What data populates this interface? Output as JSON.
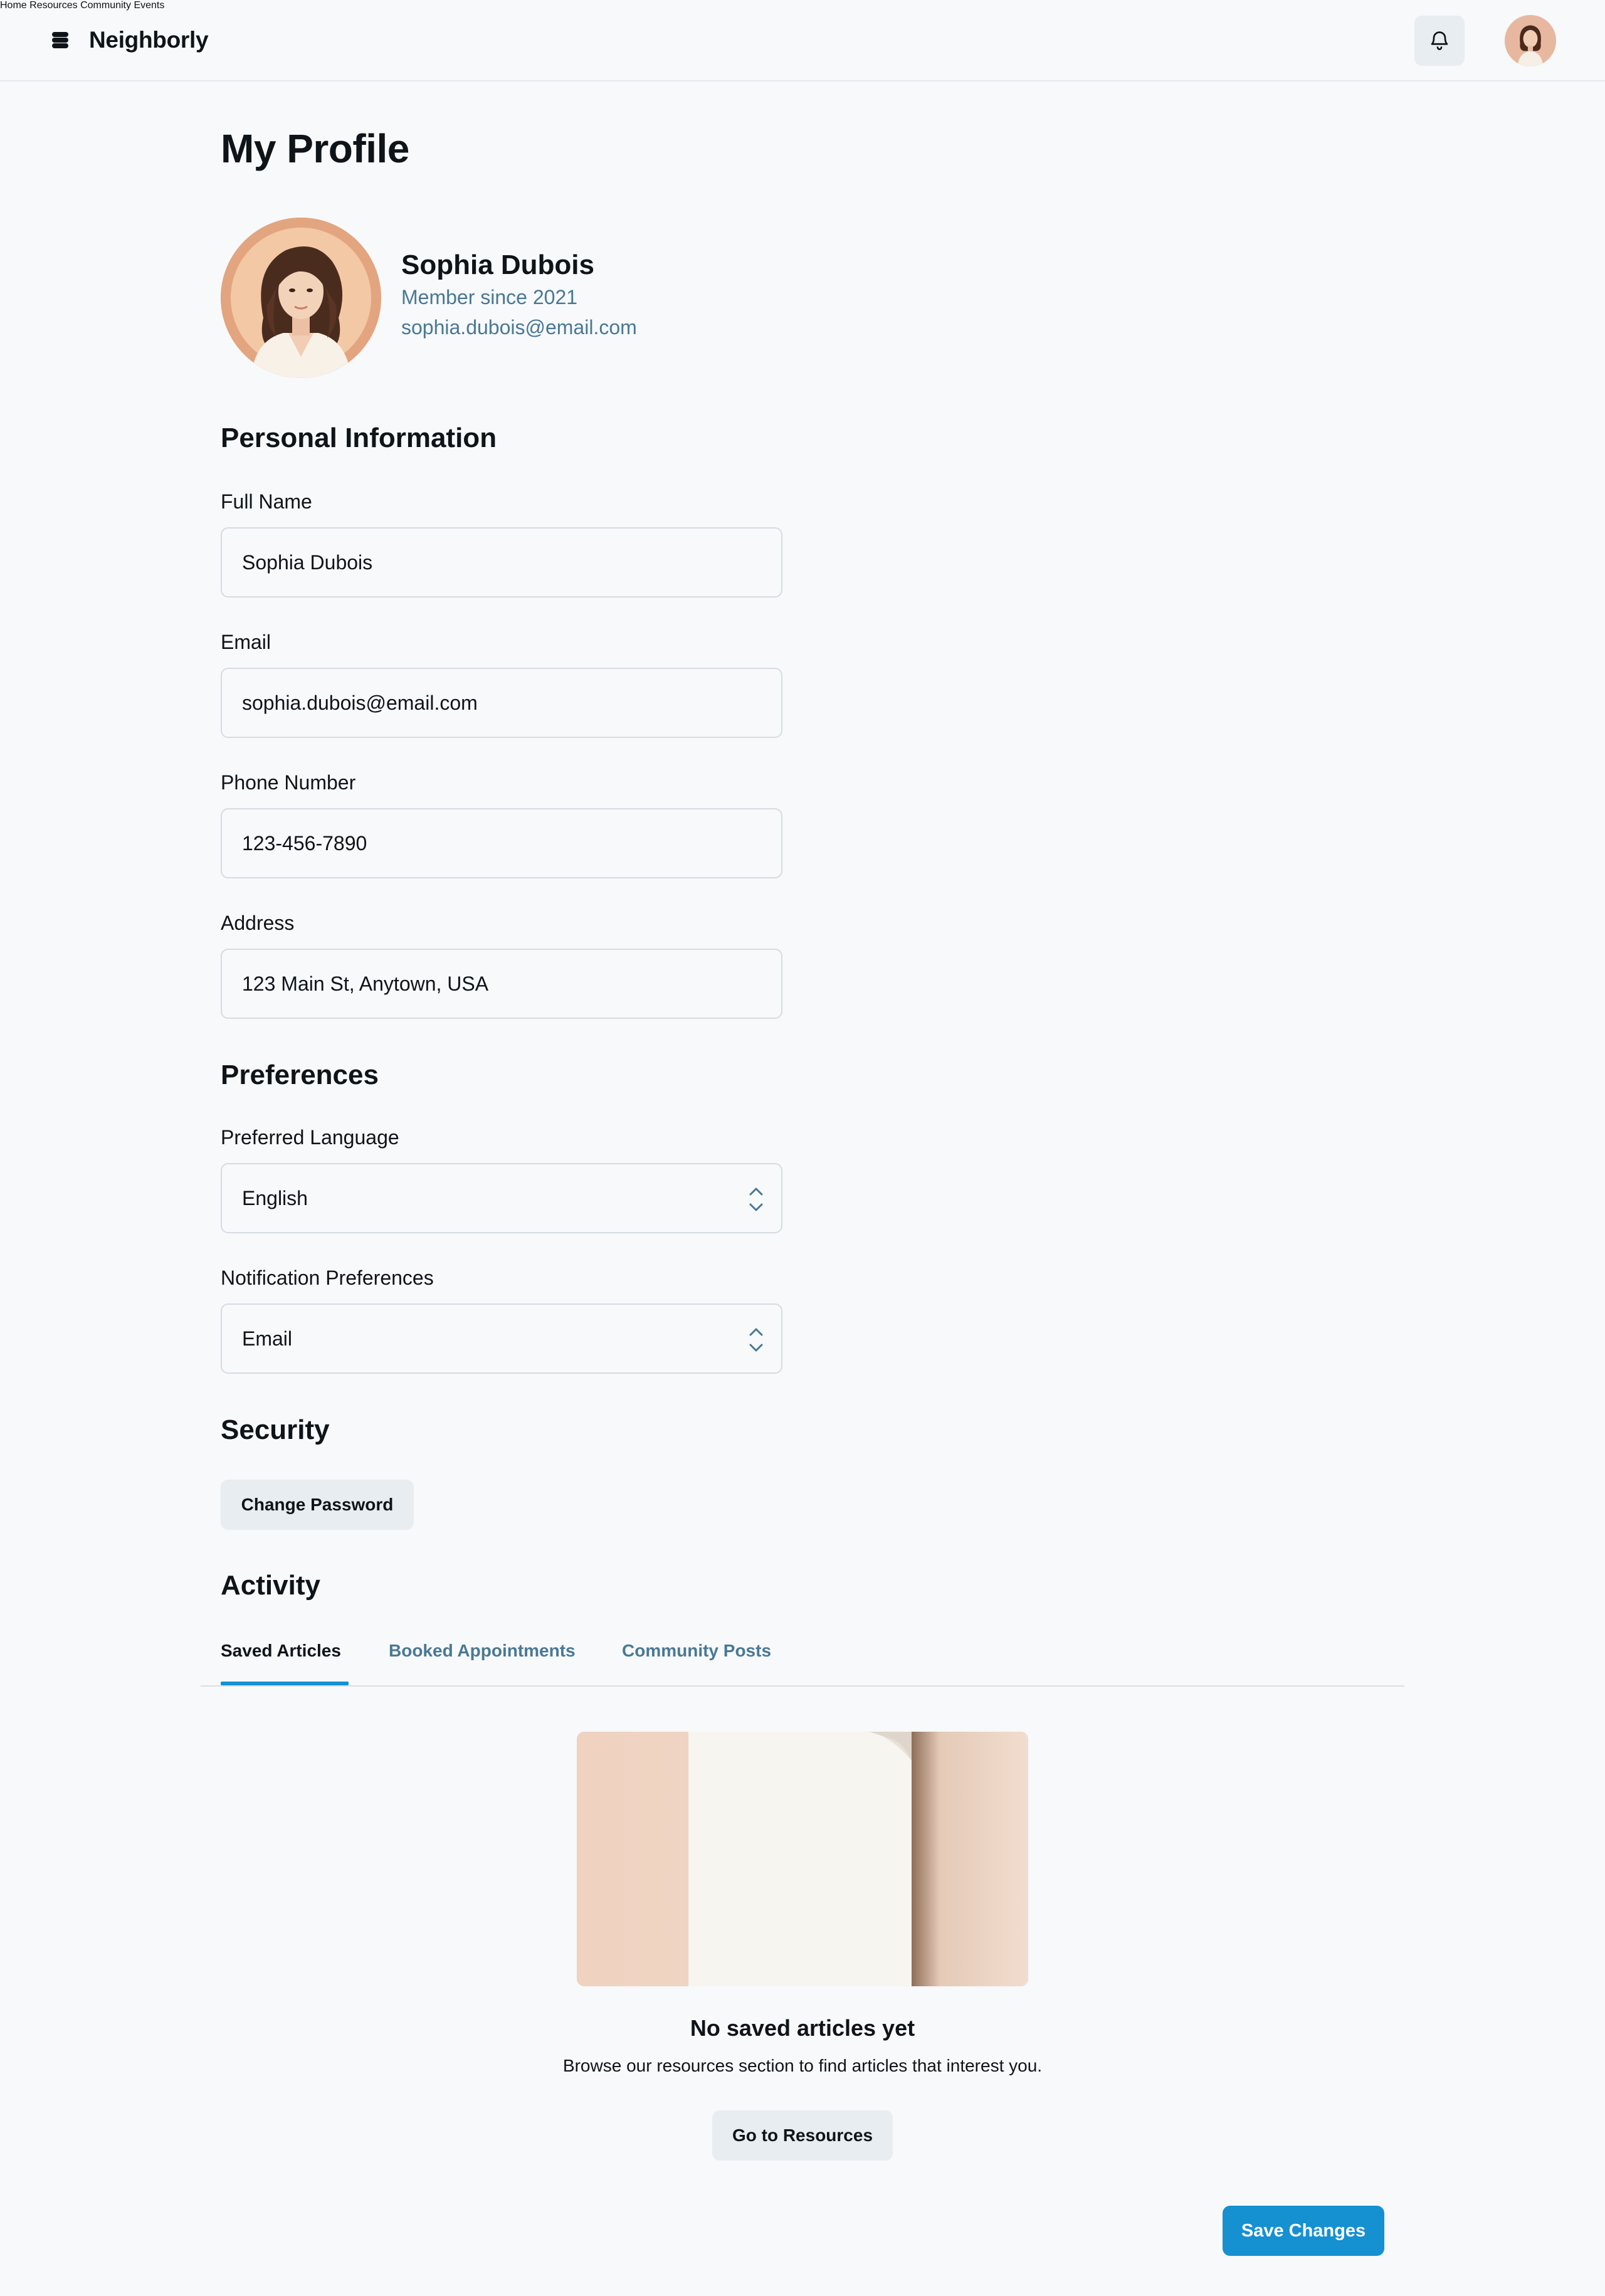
{
  "app": {
    "brand": "Neighborly"
  },
  "nav": {
    "items": [
      "Home",
      "Resources",
      "Community",
      "Events"
    ]
  },
  "page": {
    "title": "My Profile"
  },
  "profile": {
    "name": "Sophia Dubois",
    "member_since": "Member since 2021",
    "email": "sophia.dubois@email.com"
  },
  "personal": {
    "heading": "Personal Information",
    "full_name_label": "Full Name",
    "full_name_value": "Sophia Dubois",
    "email_label": "Email",
    "email_value": "sophia.dubois@email.com",
    "phone_label": "Phone Number",
    "phone_value": "123-456-7890",
    "address_label": "Address",
    "address_value": "123 Main St, Anytown, USA"
  },
  "preferences": {
    "heading": "Preferences",
    "language_label": "Preferred Language",
    "language_value": "English",
    "notification_label": "Notification Preferences",
    "notification_value": "Email"
  },
  "security": {
    "heading": "Security",
    "change_password_label": "Change Password"
  },
  "activity": {
    "heading": "Activity",
    "tabs": [
      "Saved Articles",
      "Booked Appointments",
      "Community Posts"
    ],
    "active_tab": "Saved Articles",
    "empty_title": "No saved articles yet",
    "empty_subtitle": "Browse our resources section to find articles that interest you.",
    "go_button_label": "Go to Resources"
  },
  "footer": {
    "save_label": "Save Changes"
  },
  "icons": {
    "notifications": "bell-icon",
    "logo": "stack-logo-icon",
    "select": "chevron-up-down-icon"
  },
  "colors": {
    "accent": "#1590d1",
    "link_muted": "#4a7894",
    "background": "#f7f9fb"
  }
}
